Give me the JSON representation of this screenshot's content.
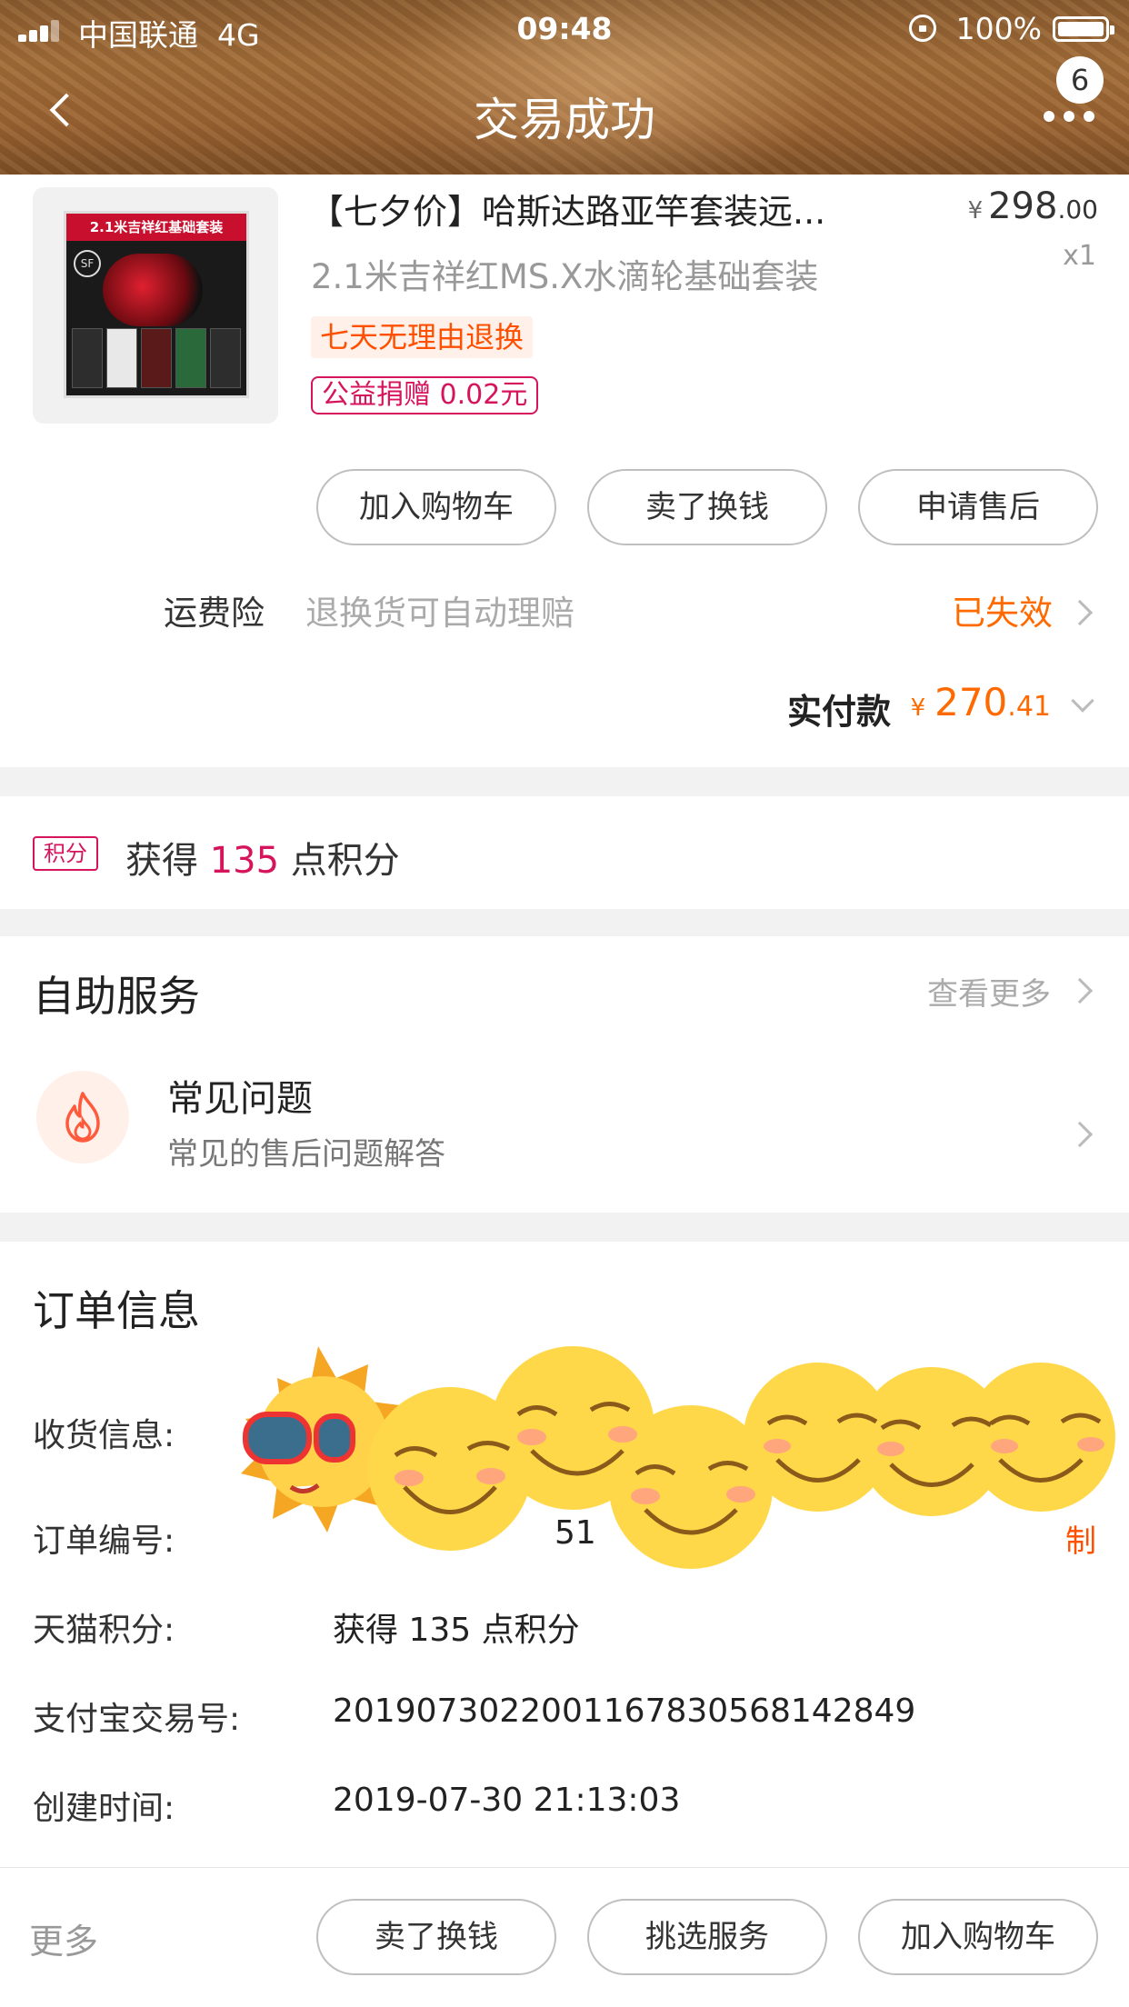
{
  "status_bar": {
    "carrier": "中国联通",
    "network": "4G",
    "time": "09:48",
    "battery": "100%"
  },
  "nav": {
    "title": "交易成功",
    "badge_count": "6"
  },
  "product": {
    "title": "【七夕价】哈斯达路亚竿套装远...",
    "sku": "2.1米吉祥红MS.X水滴轮基础套装",
    "currency": "¥",
    "price_int": "298",
    "price_dec": ".00",
    "qty": "x1",
    "tag_return": "七天无理由退换",
    "tag_charity": "公益捐赠 0.02元",
    "thumb_banner": "2.1米吉祥红基础套装",
    "thumb_sf": "SF"
  },
  "product_actions": {
    "add_cart": "加入购物车",
    "resell": "卖了换钱",
    "after_sale": "申请售后"
  },
  "insurance": {
    "label": "运费险",
    "desc": "退换货可自动理赔",
    "status": "已失效"
  },
  "payment": {
    "label": "实付款",
    "currency": "¥",
    "amount_int": "270",
    "amount_dec": ".41"
  },
  "points": {
    "icon_label": "积分",
    "prefix": "获得",
    "value": "135",
    "suffix": "点积分"
  },
  "self_service": {
    "title": "自助服务",
    "more": "查看更多",
    "faq_title": "常见问题",
    "faq_sub": "常见的售后问题解答"
  },
  "order_info": {
    "title": "订单信息",
    "receiver_label": "收货信息:",
    "order_no_label": "订单编号:",
    "order_no_value_partial": "51",
    "copy_label": "制",
    "tmall_points_label": "天猫积分:",
    "tmall_points_value": "获得 135 点积分",
    "alipay_label": "支付宝交易号:",
    "alipay_value": "2019073022001167830568142849",
    "created_label": "创建时间:",
    "created_value": "2019-07-30 21:13:03"
  },
  "bottom_bar": {
    "more": "更多",
    "resell": "卖了换钱",
    "pick_service": "挑选服务",
    "add_cart": "加入购物车"
  },
  "colors": {
    "accent_orange": "#ff6a00",
    "accent_pink": "#d6145c",
    "header_brown": "#9a6231"
  }
}
